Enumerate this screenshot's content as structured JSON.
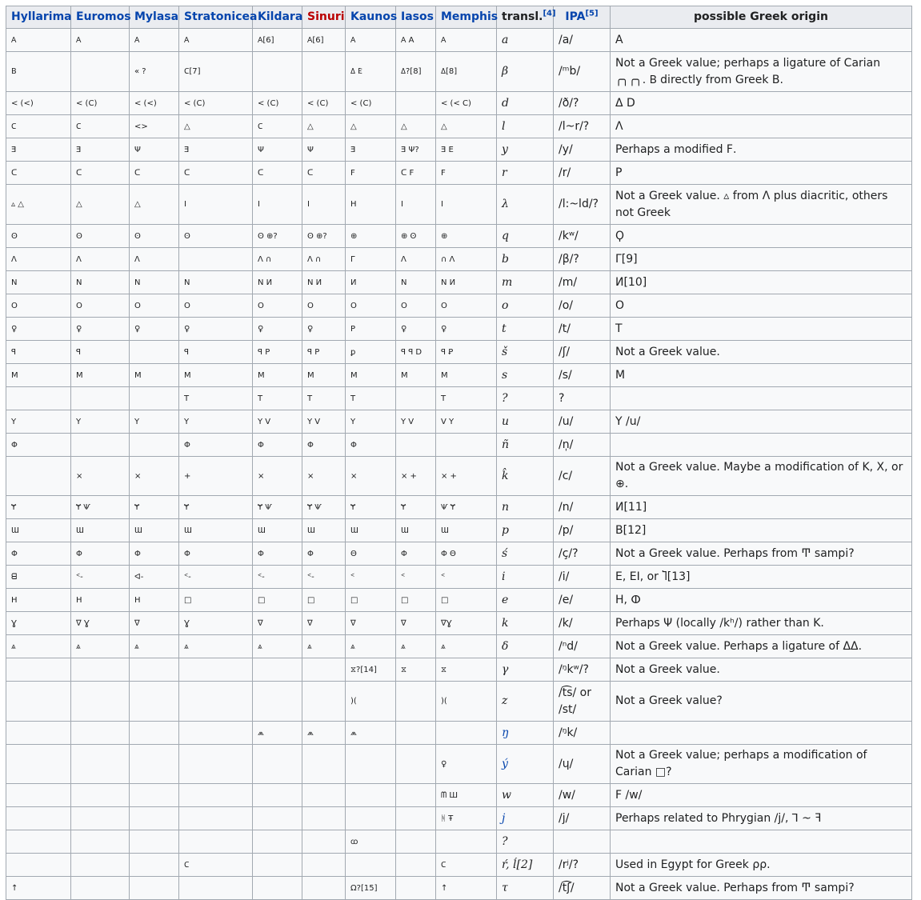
{
  "headers": [
    {
      "label": "Hyllarima",
      "link": true
    },
    {
      "label": "Euromos",
      "link": true
    },
    {
      "label": "Mylasa",
      "link": true
    },
    {
      "label": "Stratonicea",
      "link": true
    },
    {
      "label": "Kildara",
      "link": true
    },
    {
      "label": "Sinuri",
      "link": true,
      "red": true
    },
    {
      "label": "Kaunos",
      "link": true
    },
    {
      "label": "Iasos",
      "link": true
    },
    {
      "label": "Memphis",
      "link": true
    },
    {
      "label": "transl.",
      "link": false,
      "sup": "[4]"
    },
    {
      "label": "IPA",
      "link": true,
      "sup": "[5]"
    },
    {
      "label": "possible Greek origin",
      "link": false
    }
  ],
  "rows": [
    {
      "h": 21,
      "c": [
        "𐊠",
        "𐊠",
        "𐊠",
        "𐊠",
        "𐊠[6]",
        "𐊠[6]",
        "𐊠",
        "𐊠 A",
        "𐊠",
        "a",
        "/a/",
        "A"
      ]
    },
    {
      "h": 42,
      "c": [
        "𐊡",
        "",
        "« ?",
        "𐊢[7]",
        "",
        "",
        "𐊣 𐊤",
        "𐊣?[8]",
        "𐊣[8]",
        "β",
        "/ᵐb/",
        "Not a Greek value; perhaps a ligature of Carian ╭╮╭╮. 𐊡 directly from Greek B."
      ]
    },
    {
      "h": 21,
      "c": [
        "< (<)",
        "< (C)",
        "< (<)",
        "< (C)",
        "< (C)",
        "< (C)",
        "< (C)",
        "",
        "< (< C)",
        "d",
        "/ð/?",
        "Δ D"
      ]
    },
    {
      "h": 21,
      "c": [
        "𐊢",
        "𐊢",
        "<>",
        "△",
        "𐊢",
        "△",
        "△",
        "△",
        "△",
        "l",
        "/l~r/?",
        "Λ"
      ]
    },
    {
      "h": 21,
      "c": [
        "Ǝ",
        "Ǝ",
        "Ψ",
        "Ǝ",
        "Ψ",
        "Ψ",
        "Ǝ",
        "Ǝ Ψ?",
        "Ǝ E",
        "y",
        "/y/",
        "Perhaps a modified Ϝ."
      ]
    },
    {
      "h": 21,
      "c": [
        "ᑕ",
        "ᑕ",
        "ᑕ",
        "ᑕ",
        "ᑕ",
        "ᑕ",
        "F",
        "ᑕ F",
        "F",
        "r",
        "/r/",
        "P"
      ]
    },
    {
      "h": 42,
      "c": [
        "▵ △",
        "△",
        "△",
        "I",
        "I",
        "I",
        "H",
        "I",
        "I",
        "λ",
        "/l:~ld/?",
        "Not a Greek value. ▵ from Λ plus diacritic, others not Greek"
      ]
    },
    {
      "h": 21,
      "c": [
        "ʘ",
        "ʘ",
        "ʘ",
        "ʘ",
        "ʘ ⊕?",
        "ʘ ⊕?",
        "⊕",
        "⊕ ʘ",
        "⊕",
        "q",
        "/kʷ/",
        "Ϙ"
      ]
    },
    {
      "h": 21,
      "c": [
        "Λ",
        "Λ",
        "Λ",
        "",
        "Λ ∩",
        "Λ ∩",
        "Γ",
        "Λ",
        "∩ Λ",
        "b",
        "/β/?",
        "Γ[9]"
      ]
    },
    {
      "h": 21,
      "c": [
        "N",
        "N",
        "N",
        "N",
        "N И",
        "N И",
        "И",
        "N",
        "N И",
        "m",
        "/m/",
        "Ͷ[10]"
      ]
    },
    {
      "h": 21,
      "c": [
        "O",
        "O",
        "O",
        "O",
        "O",
        "O",
        "O",
        "O",
        "O",
        "o",
        "/o/",
        "O"
      ]
    },
    {
      "h": 21,
      "c": [
        "♀",
        "♀",
        "♀",
        "♀",
        "♀",
        "♀",
        "P",
        "♀",
        "♀",
        "t",
        "/t/",
        "T"
      ]
    },
    {
      "h": 21,
      "c": [
        "ꟼ",
        "ꟼ",
        "",
        "ꟼ",
        "ꟼ P",
        "ꟼ P",
        "ꝑ",
        "ꟼ ꟼ D",
        "ꟼ Ꝑ",
        "š",
        "/ʃ/",
        "Not a Greek value."
      ]
    },
    {
      "h": 21,
      "c": [
        "M",
        "M",
        "M",
        "M",
        "M",
        "M",
        "M",
        "M",
        "M",
        "s",
        "/s/",
        "M"
      ]
    },
    {
      "h": 21,
      "c": [
        "",
        "",
        "",
        "T",
        "T",
        "T",
        "T",
        "",
        "T",
        "?",
        "?",
        ""
      ]
    },
    {
      "h": 21,
      "c": [
        "Y",
        "Y",
        "Y",
        "Y",
        "Y V",
        "Y V",
        "Y",
        "Y V",
        "V Y",
        "u",
        "/u/",
        "Y /u/"
      ]
    },
    {
      "h": 21,
      "c": [
        "Φ",
        "",
        "",
        "Φ",
        "Φ",
        "Φ",
        "Φ",
        "",
        "",
        "ñ",
        "/n̩/",
        ""
      ]
    },
    {
      "h": 21,
      "c": [
        "",
        "×",
        "×",
        "+",
        "×",
        "×",
        "×",
        "× +",
        "× +",
        "k̂",
        "/c/",
        "Not a Greek value. Maybe a modification of K, X, or ⊕."
      ]
    },
    {
      "h": 21,
      "c": [
        "Ɏ",
        "Ɏ Ѱ",
        "Ɏ",
        "Ɏ",
        "Ɏ Ѱ",
        "Ɏ Ѱ",
        "Ɏ",
        "Ɏ",
        "Ѱ Ɏ",
        "n",
        "/n/",
        "Ͷ[11]"
      ]
    },
    {
      "h": 21,
      "c": [
        "Ɯ",
        "Ɯ",
        "Ɯ",
        "Ɯ",
        "Ɯ",
        "Ɯ",
        "Ɯ",
        "Ɯ",
        "Ɯ",
        "p",
        "/p/",
        "B[12]"
      ]
    },
    {
      "h": 21,
      "c": [
        "Φ",
        "Φ",
        "Φ",
        "Φ",
        "Φ",
        "Φ",
        "Θ",
        "Φ",
        "Φ Θ",
        "ś",
        "/ç/?",
        "Not a Greek value. Perhaps from Ͳ sampi?"
      ]
    },
    {
      "h": 21,
      "c": [
        "ᗺ",
        "ᑉ-",
        "ᐊ-",
        "ᑉ-",
        "ᑉ-",
        "ᑉ-",
        "ᑉ",
        "ᑉ",
        "ᑉ",
        "i",
        "/i/",
        "E, EI, or Ⴈ[13]"
      ]
    },
    {
      "h": 21,
      "c": [
        "H",
        "H",
        "H",
        "□",
        "□",
        "□",
        "□",
        "□",
        "□",
        "e",
        "/e/",
        "H, ⵀ"
      ]
    },
    {
      "h": 21,
      "c": [
        "Ɣ",
        "∇ Ɣ",
        "∇",
        "Ɣ",
        "∇",
        "∇",
        "∇",
        "∇",
        "∇Ɣ",
        "k",
        "/k/",
        "Perhaps Ψ (locally /kʰ/) rather than K."
      ]
    },
    {
      "h": 21,
      "c": [
        "⩓",
        "⩓",
        "⩓",
        "⩓",
        "⩓",
        "⩓",
        "⩓",
        "⩓",
        "⩓",
        "δ",
        "/ⁿd/",
        "Not a Greek value. Perhaps a ligature of ΔΔ."
      ]
    },
    {
      "h": 21,
      "c": [
        "",
        "",
        "",
        "",
        "",
        "",
        "⧖?[14]",
        "⧖",
        "⧖",
        "γ",
        "/ᵑkʷ/?",
        "Not a Greek value."
      ]
    },
    {
      "h": 42,
      "c": [
        "",
        "",
        "",
        "",
        "",
        "",
        ")(",
        "",
        ")(",
        "z",
        "/t͡s/ or /st/",
        "Not a Greek value?"
      ]
    },
    {
      "h": 21,
      "c": [
        "",
        "",
        "",
        "",
        "⩕",
        "⩕",
        "⩕",
        "",
        "",
        "ŋ",
        "/ᵑk/",
        ""
      ],
      "blueTr": true
    },
    {
      "h": 21,
      "c": [
        "",
        "",
        "",
        "",
        "",
        "",
        "",
        "",
        "♀",
        "ý",
        "/ɥ/",
        "Not a Greek value; perhaps a modification of Carian □?"
      ],
      "blueTr": true
    },
    {
      "h": 21,
      "c": [
        "",
        "",
        "",
        "",
        "",
        "",
        "",
        "",
        "ᗰ Ш",
        "w",
        "/w/",
        "Ϝ /w/"
      ]
    },
    {
      "h": 21,
      "c": [
        "",
        "",
        "",
        "",
        "",
        "",
        "",
        "",
        "ᚻ Ŧ",
        "j",
        "/j/",
        "Perhaps related to Phrygian /j/, ꓶ ~ ꟻ"
      ],
      "blueTr": true
    },
    {
      "h": 21,
      "c": [
        "",
        "",
        "",
        "",
        "",
        "",
        "ꭃ",
        "",
        "",
        "?",
        "",
        ""
      ]
    },
    {
      "h": 21,
      "c": [
        "",
        "",
        "",
        "𐊢",
        "",
        "",
        "",
        "",
        "𐊢",
        "ŕ, ĺ[2]",
        "/rʲ/?",
        "Used in Egypt for Greek ρρ."
      ]
    },
    {
      "h": 21,
      "c": [
        "↑",
        "",
        "",
        "",
        "",
        "",
        "Ω?[15]",
        "",
        "↑",
        "τ",
        "/t͡ʃ/",
        "Not a Greek value. Perhaps from Ͳ sampi?"
      ]
    }
  ]
}
